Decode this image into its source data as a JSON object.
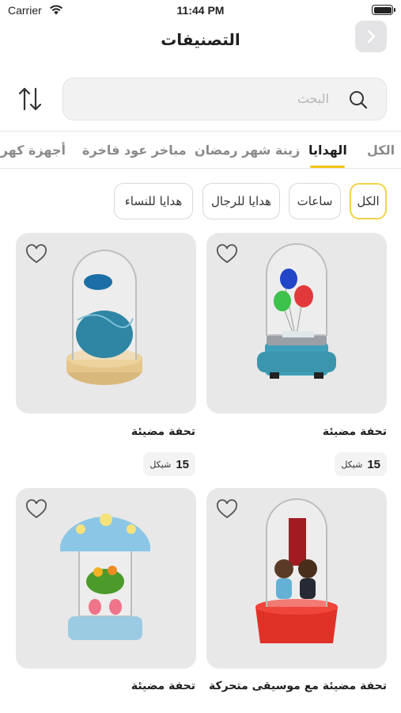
{
  "status_bar": {
    "carrier": "Carrier",
    "time": "11:44 PM"
  },
  "header": {
    "title": "التصنيفات"
  },
  "search": {
    "placeholder": "البحث"
  },
  "tabs": [
    {
      "label": "الكل",
      "active": false
    },
    {
      "label": "الهدايا",
      "active": true
    },
    {
      "label": "زينة شهر رمضان",
      "active": false
    },
    {
      "label": "مباخر عود فاخرة",
      "active": false
    },
    {
      "label": "أجهزة كهربائية",
      "active": false
    }
  ],
  "chips": [
    {
      "label": "الكل",
      "active": true
    },
    {
      "label": "ساعات",
      "active": false
    },
    {
      "label": "هدايا للرجال",
      "active": false
    },
    {
      "label": "هدايا للنساء",
      "active": false
    }
  ],
  "products": [
    {
      "name": "تحفة مضيئة",
      "price": "15",
      "currency": "شيكل",
      "image": "glass-dome-balloons"
    },
    {
      "name": "تحفة مضيئة",
      "price": "15",
      "currency": "شيكل",
      "image": "glass-dome-blue-flowers"
    },
    {
      "name": "تحفة مضيئة مع موسيقى متحركة",
      "price": "",
      "currency": "",
      "image": "glass-dome-couple-music-box"
    },
    {
      "name": "تحفة مضيئة",
      "price": "",
      "currency": "",
      "image": "glass-dome-mushroom-flamingos"
    }
  ],
  "colors": {
    "accent": "#f3c613",
    "card_bg": "#e8e8e9"
  },
  "icons": [
    "wifi-icon",
    "battery-icon",
    "chevron-right-icon",
    "search-icon",
    "sort-icon",
    "heart-icon"
  ]
}
